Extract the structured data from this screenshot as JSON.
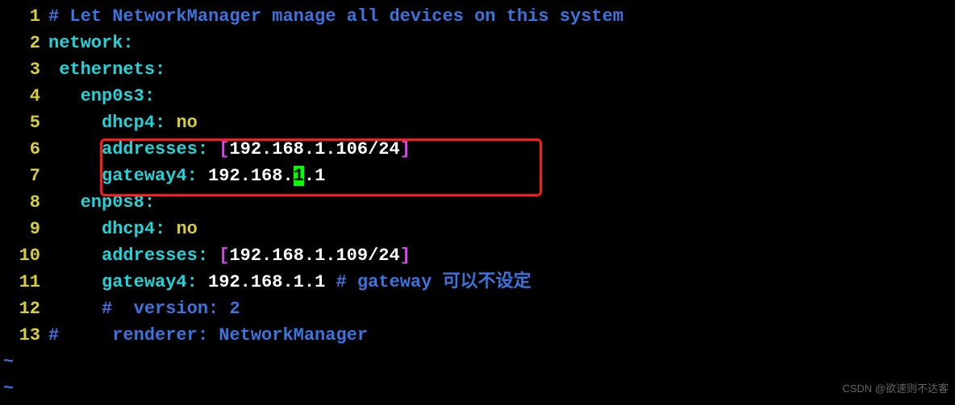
{
  "lines": {
    "l1": {
      "num": "1",
      "comment": "# Let NetworkManager manage all devices on this system"
    },
    "l2": {
      "num": "2",
      "key": "network",
      "colon": ":"
    },
    "l3": {
      "num": "3",
      "indent": " ",
      "key": "ethernets",
      "colon": ":"
    },
    "l4": {
      "num": "4",
      "indent": "   ",
      "key": "enp0s3",
      "colon": ":"
    },
    "l5": {
      "num": "5",
      "indent": "     ",
      "key": "dhcp4",
      "colon": ":",
      "sep": " ",
      "val": "no"
    },
    "l6": {
      "num": "6",
      "indent": "     ",
      "key": "addresses",
      "colon": ":",
      "sep": " ",
      "lbr": "[",
      "val": "192.168.1.106/24",
      "rbr": "]"
    },
    "l7": {
      "num": "7",
      "indent": "     ",
      "key": "gateway4",
      "colon": ":",
      "sep": " ",
      "pre": "192.168.",
      "cursor": "1",
      "post": ".1"
    },
    "l8": {
      "num": "8",
      "indent": "   ",
      "key": "enp0s8",
      "colon": ":"
    },
    "l9": {
      "num": "9",
      "indent": "     ",
      "key": "dhcp4",
      "colon": ":",
      "sep": " ",
      "val": "no"
    },
    "l10": {
      "num": "10",
      "indent": "     ",
      "key": "addresses",
      "colon": ":",
      "sep": " ",
      "lbr": "[",
      "val": "192.168.1.109/24",
      "rbr": "]"
    },
    "l11": {
      "num": "11",
      "indent": "     ",
      "key": "gateway4",
      "colon": ":",
      "sep": " ",
      "val": "192.168.1.1 ",
      "comment": "# gateway 可以不设定"
    },
    "l12": {
      "num": "12",
      "indent": "     ",
      "comment": "#  version: 2"
    },
    "l13": {
      "num": "13",
      "comment": "#     renderer: NetworkManager"
    }
  },
  "tilde": "~",
  "watermark": "CSDN @欲速则不达客"
}
